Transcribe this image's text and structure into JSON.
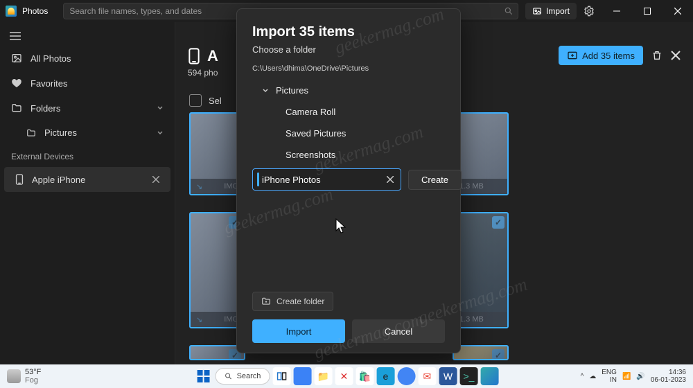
{
  "app": {
    "title": "Photos"
  },
  "search": {
    "placeholder": "Search file names, types, and dates"
  },
  "toolbar": {
    "import": "Import"
  },
  "sidebar": {
    "all_photos": "All Photos",
    "favorites": "Favorites",
    "folders": "Folders",
    "pictures": "Pictures",
    "ext_devices": "External Devices",
    "device": "Apple iPhone"
  },
  "page": {
    "title_prefix": "A",
    "subtitle": "594 pho",
    "add_btn": "Add 35 items",
    "select_prefix": "Sel"
  },
  "thumbs": {
    "t1": {
      "name": "IMG",
      "size": "1.3 MB"
    },
    "t2": {
      "name": "IMG",
      "size": "1.3 MB"
    }
  },
  "dialog": {
    "title": "Import 35 items",
    "subtitle": "Choose a folder",
    "path": "C:\\Users\\dhima\\OneDrive\\Pictures",
    "root": "Pictures",
    "children": {
      "c0": "Camera Roll",
      "c1": "Saved Pictures",
      "c2": "Screenshots"
    },
    "new_folder_value": "iPhone Photos",
    "create": "Create",
    "create_folder": "Create folder",
    "import": "Import",
    "cancel": "Cancel"
  },
  "watermark": "geekermag.com",
  "taskbar": {
    "temp": "53°F",
    "cond": "Fog",
    "search": "Search",
    "lang1": "ENG",
    "lang2": "IN",
    "time": "14:36",
    "date": "06-01-2023"
  }
}
